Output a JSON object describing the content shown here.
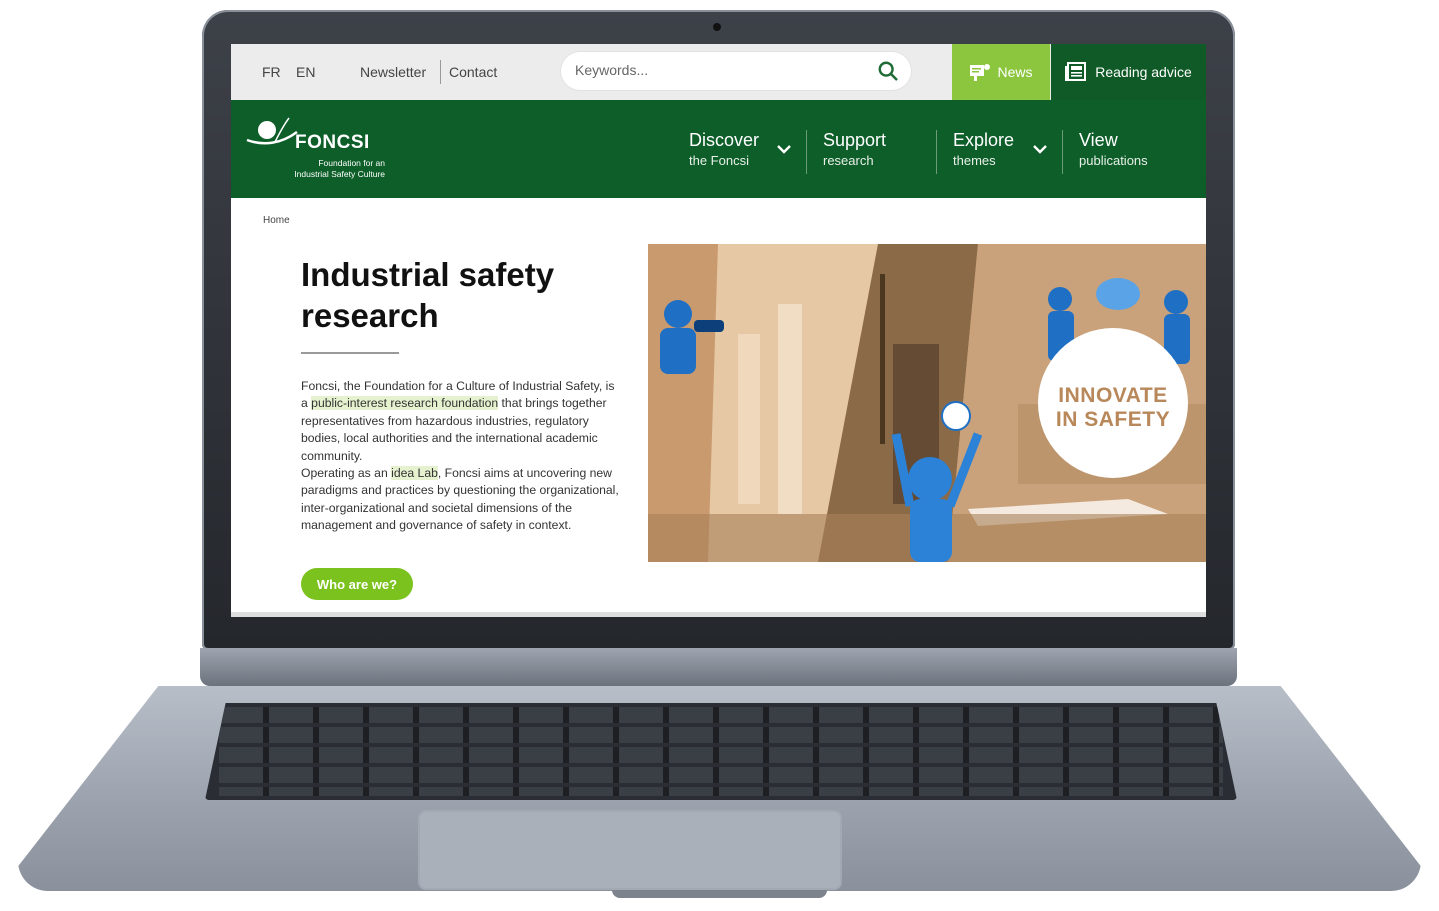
{
  "topbar": {
    "languages": [
      "FR",
      "EN"
    ],
    "links": [
      "Newsletter",
      "Contact"
    ],
    "search": {
      "placeholder": "Keywords..."
    },
    "news_label": "News",
    "reading_label": "Reading advice"
  },
  "brand": {
    "name": "FONCSI",
    "tagline_line1": "Foundation for an",
    "tagline_line2": "Industrial Safety Culture"
  },
  "nav": [
    {
      "main": "Discover",
      "sub": "the Foncsi",
      "has_dropdown": true
    },
    {
      "main": "Support",
      "sub": "research",
      "has_dropdown": false
    },
    {
      "main": "Explore",
      "sub": "themes",
      "has_dropdown": true
    },
    {
      "main": "View",
      "sub": "publications",
      "has_dropdown": false
    }
  ],
  "breadcrumb": "Home",
  "hero": {
    "title": "Industrial safety research",
    "intro": {
      "p1_a": "Foncsi, the Foundation for a Culture of Industrial Safety, is a ",
      "p1_highlight": "public-interest research foundation",
      "p1_b": " that brings together representatives from hazardous industries, regulatory bodies, local authorities and the international academic community.",
      "p2_a": "Operating as an ",
      "p2_highlight": "idea Lab",
      "p2_b": ", Foncsi aims at uncovering new paradigms and practices by questioning the organizational, inter-organizational and societal dimensions of the management and governance of safety in context."
    },
    "cta_label": "Who are we?",
    "badge_line1": "INNOVATE",
    "badge_line2": "IN SAFETY"
  },
  "colors": {
    "primary_green": "#0e5e2a",
    "accent_green": "#8cc63f",
    "cta_green": "#7cc21e",
    "badge_text": "#b8875a"
  }
}
